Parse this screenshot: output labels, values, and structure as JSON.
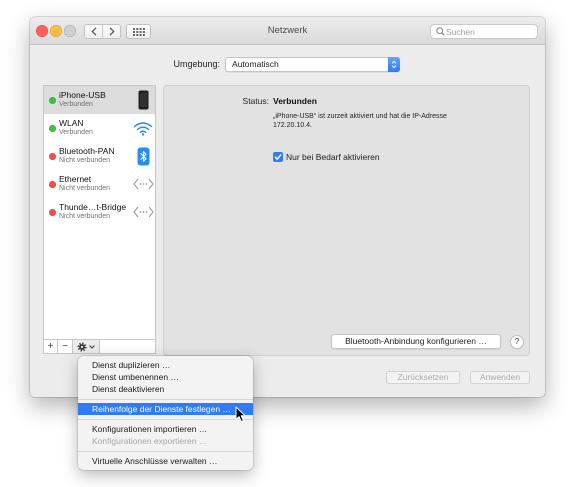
{
  "window": {
    "title": "Netzwerk",
    "search_placeholder": "Suchen",
    "traffic_lights": [
      "#fc605c",
      "#fdbc40",
      "#cecece"
    ]
  },
  "location": {
    "label": "Umgebung:",
    "value": "Automatisch"
  },
  "services": [
    {
      "name": "iPhone-USB",
      "status": "Verbunden",
      "dot_color": "#3ec23e",
      "icon": "iphone-icon",
      "selected": true
    },
    {
      "name": "WLAN",
      "status": "Verbunden",
      "dot_color": "#3ec23e",
      "icon": "wifi-icon",
      "selected": false
    },
    {
      "name": "Bluetooth-PAN",
      "status": "Nicht verbunden",
      "dot_color": "#f0504b",
      "icon": "bluetooth-icon",
      "selected": false
    },
    {
      "name": "Ethernet",
      "status": "Nicht verbunden",
      "dot_color": "#f0504b",
      "icon": "ethernet-icon",
      "selected": false
    },
    {
      "name": "Thunde…t-Bridge",
      "status": "Nicht verbunden",
      "dot_color": "#f0504b",
      "icon": "ethernet-icon",
      "selected": false
    }
  ],
  "list_toolbar": {
    "add_label": "+",
    "remove_label": "−",
    "actions_icon": "gear-icon"
  },
  "detail": {
    "status_label": "Status:",
    "status_value": "Verbunden",
    "description_line1": "„iPhone-USB“ ist zurzeit aktiviert und hat die IP-Adresse",
    "description_line2": "172.20.10.4.",
    "checkbox_label": "Nur bei Bedarf aktivieren",
    "checkbox_checked": true,
    "configure_button": "Bluetooth-Anbindung konfigurieren …",
    "help_label": "?"
  },
  "footer": {
    "revert_label": "Zurücksetzen",
    "apply_label": "Anwenden",
    "revert_disabled": true,
    "apply_disabled": true
  },
  "context_menu": {
    "items": [
      {
        "label": "Dienst duplizieren …"
      },
      {
        "label": "Dienst umbenennen …"
      },
      {
        "label": "Dienst deaktivieren"
      },
      {
        "label": "Reihenfolge der Dienste festlegen …",
        "highlighted": true
      },
      {
        "label": "Konfigurationen importieren …"
      },
      {
        "label": "Konfigurationen exportieren …",
        "disabled": true
      },
      {
        "label": "Virtuelle Anschlüsse verwalten …"
      }
    ]
  },
  "colors": {
    "accent": "#2f7cf6"
  }
}
